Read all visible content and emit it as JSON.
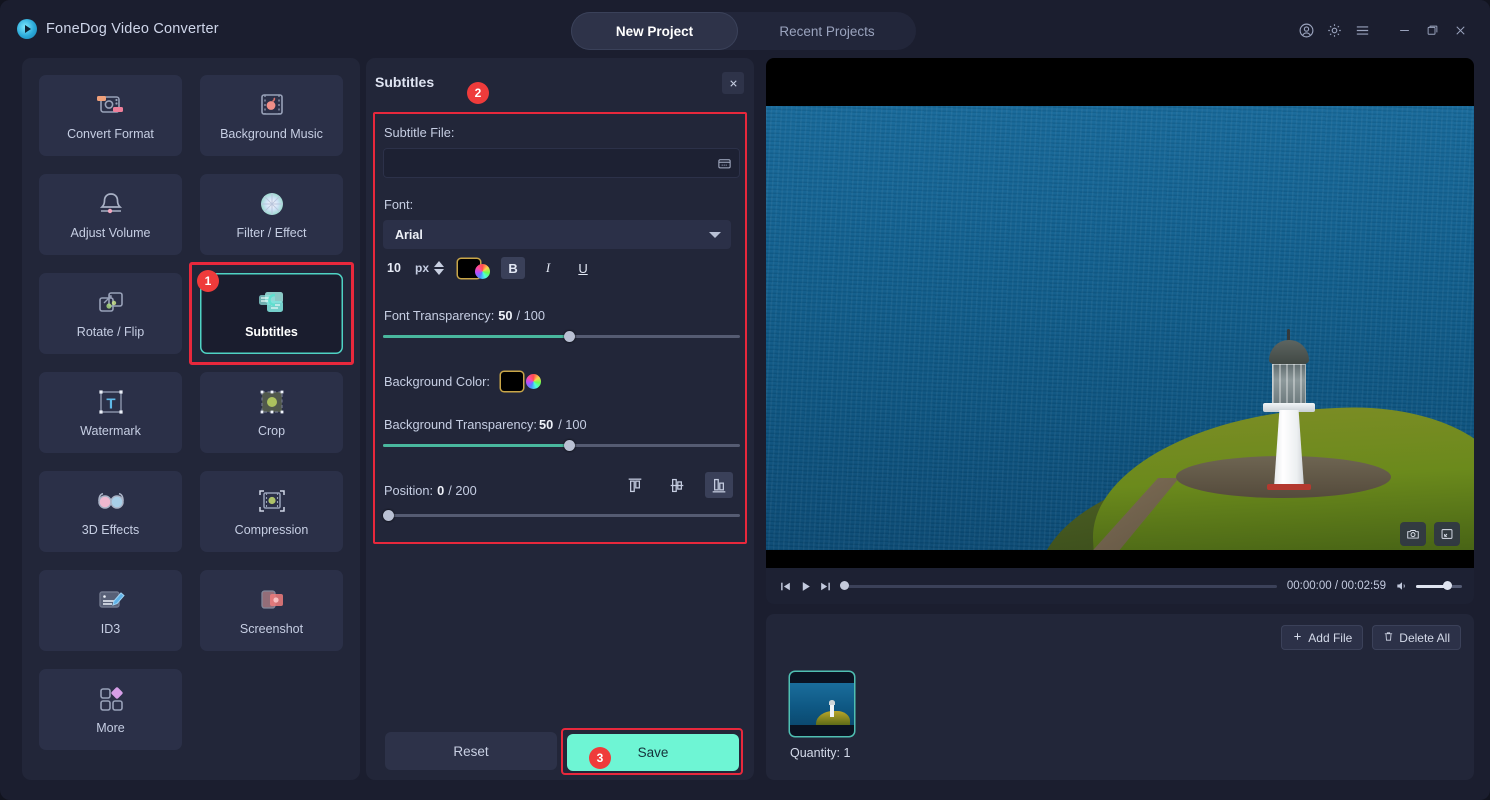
{
  "app": {
    "brand": "FoneDog Video Converter",
    "logo_icon": "play-circle-logo"
  },
  "tabs": [
    {
      "label": "New Project",
      "active": true
    },
    {
      "label": "Recent Projects",
      "active": false
    }
  ],
  "window_controls": [
    {
      "name": "account-icon"
    },
    {
      "name": "gear-icon"
    },
    {
      "name": "menu-icon"
    },
    {
      "name": "minimize-icon"
    },
    {
      "name": "maximize-icon"
    },
    {
      "name": "close-icon"
    }
  ],
  "tools": [
    {
      "label": "Convert Format",
      "icon": "convert-format-icon",
      "selected": false
    },
    {
      "label": "Background Music",
      "icon": "background-music-icon",
      "selected": false
    },
    {
      "label": "Adjust Volume",
      "icon": "adjust-volume-icon",
      "selected": false
    },
    {
      "label": "Filter / Effect",
      "icon": "filter-effect-icon",
      "selected": false
    },
    {
      "label": "Rotate / Flip",
      "icon": "rotate-flip-icon",
      "selected": false
    },
    {
      "label": "Subtitles",
      "icon": "subtitles-icon",
      "selected": true,
      "badge": "1"
    },
    {
      "label": "Watermark",
      "icon": "watermark-icon",
      "selected": false
    },
    {
      "label": "Crop",
      "icon": "crop-icon",
      "selected": false
    },
    {
      "label": "3D Effects",
      "icon": "3d-effects-icon",
      "selected": false
    },
    {
      "label": "Compression",
      "icon": "compression-icon",
      "selected": false
    },
    {
      "label": "ID3",
      "icon": "id3-icon",
      "selected": false
    },
    {
      "label": "Screenshot",
      "icon": "screenshot-icon",
      "selected": false
    },
    {
      "label": "More",
      "icon": "more-icon",
      "selected": false
    }
  ],
  "subtitles_panel": {
    "title": "Subtitles",
    "badge": "2",
    "close_icon": "close-icon",
    "subtitle_file_label": "Subtitle File:",
    "subtitle_file_value": "",
    "subtitle_file_placeholder": "",
    "browse_icon": "folder-browse-icon",
    "font_label": "Font:",
    "font_value": "Arial",
    "font_options": [
      "Arial"
    ],
    "font_size": "10",
    "font_size_unit": "px",
    "font_color": "#000000",
    "bold_label": "B",
    "italic_label": "I",
    "underline_label": "U",
    "bold_active": true,
    "font_transparency_label": "Font Transparency:",
    "font_transparency_value": "50",
    "font_transparency_max": "/ 100",
    "background_color_label": "Background Color:",
    "background_color": "#000000",
    "background_transparency_label": "Background Transparency:",
    "background_transparency_value": "50",
    "background_transparency_max": "/ 100",
    "position_label": "Position:",
    "position_value": "0",
    "position_max": "/ 200",
    "align_buttons": [
      {
        "name": "align-top-icon",
        "active": false
      },
      {
        "name": "align-middle-icon",
        "active": false
      },
      {
        "name": "align-bottom-icon",
        "active": true
      }
    ],
    "reset_label": "Reset",
    "save_label": "Save",
    "save_badge": "3"
  },
  "preview": {
    "screenshot_icon": "camera-icon",
    "fullscreen_icon": "fullscreen-icon",
    "prev_icon": "skip-previous-icon",
    "play_icon": "play-icon",
    "next_icon": "skip-next-icon",
    "volume_icon": "volume-icon",
    "current_time": "00:00:00",
    "total_time": "00:02:59",
    "time_display": "00:00:00 / 00:02:59"
  },
  "file_list": {
    "add_file_label": "Add File",
    "add_file_icon": "plus-icon",
    "delete_all_label": "Delete All",
    "delete_all_icon": "trash-icon",
    "quantity_label": "Quantity: 1",
    "thumbnail_name": "video-thumbnail"
  },
  "colors": {
    "accent_teal": "#6ef5d4",
    "highlight_red": "#e8283c",
    "badge_red": "#ef3b3b",
    "panel_bg": "#222639",
    "app_bg": "#1b1e2f",
    "slider_fill": "#49b79e"
  }
}
